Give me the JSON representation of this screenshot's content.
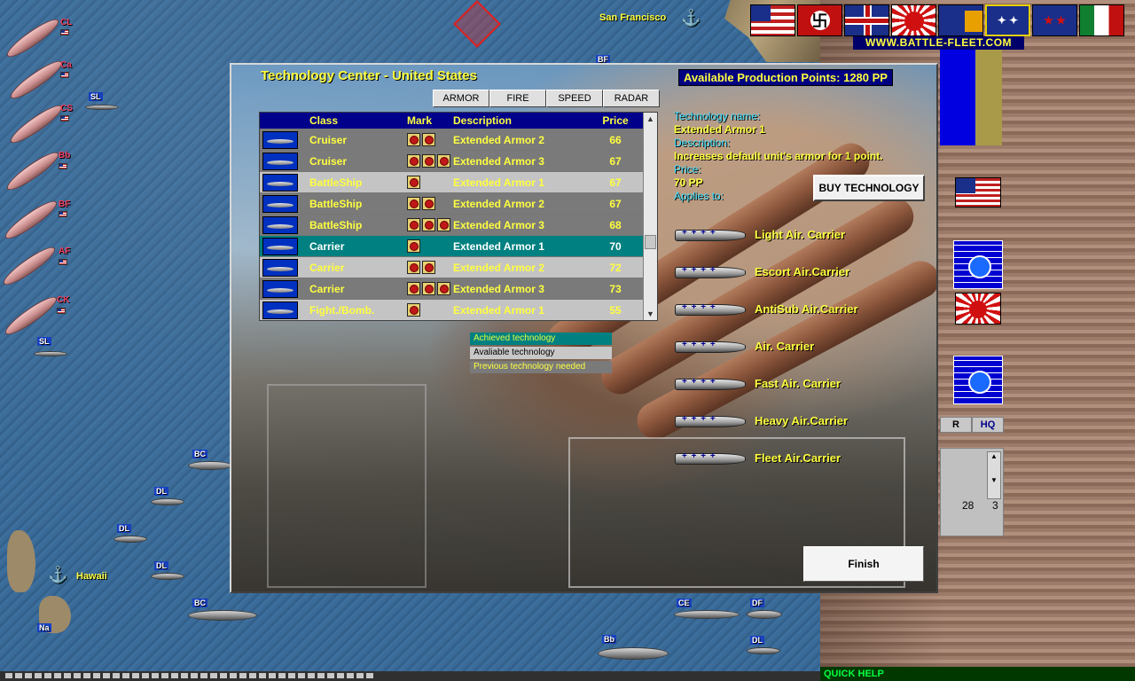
{
  "map": {
    "places": [
      "San Francisco",
      "Hawaii"
    ],
    "fleet_labels": [
      "CL",
      "Ca",
      "CS",
      "Bb",
      "BF",
      "AF",
      "CK"
    ],
    "unit_labels": [
      "SL",
      "SL",
      "BC",
      "DL",
      "DL",
      "DL",
      "BC",
      "Bb",
      "CE",
      "DF",
      "DL",
      "BF",
      "Na"
    ]
  },
  "site": {
    "link": "WWW.BATTLE-FLEET.COM"
  },
  "nations": [
    "usa-flag",
    "germany-flag",
    "uk-flag",
    "japan-flag",
    "australia-flag",
    "australia-flag-alt",
    "new-zealand-flag",
    "italy-flag"
  ],
  "sidebar": {
    "tab_r": "R",
    "tab_hq": "HQ",
    "num_a": "28",
    "num_b": "3"
  },
  "quick_help": "QUICK HELP",
  "dialog": {
    "title": "Technology Center - United States",
    "production": "Available Production Points: 1280 PP",
    "tabs": [
      "ARMOR",
      "FIRE",
      "SPEED",
      "RADAR"
    ],
    "columns": {
      "class": "Class",
      "mark": "Mark",
      "description": "Description",
      "price": "Price"
    },
    "rows": [
      {
        "class": "Cruiser",
        "marks": 2,
        "description": "Extended Armor 2",
        "price": "66",
        "status": "prev"
      },
      {
        "class": "Cruiser",
        "marks": 3,
        "description": "Extended Armor 3",
        "price": "67",
        "status": "prev"
      },
      {
        "class": "BattleShip",
        "marks": 1,
        "description": "Extended Armor 1",
        "price": "67",
        "status": "avail"
      },
      {
        "class": "BattleShip",
        "marks": 2,
        "description": "Extended Armor 2",
        "price": "67",
        "status": "prev"
      },
      {
        "class": "BattleShip",
        "marks": 3,
        "description": "Extended Armor 3",
        "price": "68",
        "status": "prev"
      },
      {
        "class": "Carrier",
        "marks": 1,
        "description": "Extended Armor 1",
        "price": "70",
        "status": "achieved"
      },
      {
        "class": "Carrier",
        "marks": 2,
        "description": "Extended Armor 2",
        "price": "72",
        "status": "avail"
      },
      {
        "class": "Carrier",
        "marks": 3,
        "description": "Extended Armor 3",
        "price": "73",
        "status": "prev"
      },
      {
        "class": "Fight./Bomb.",
        "marks": 1,
        "description": "Extended Armor 1",
        "price": "55",
        "status": "avail"
      }
    ],
    "legend": {
      "achieved": "Achieved technology",
      "available": "Avaliable technology",
      "previous": "Previous technology needed"
    },
    "info": {
      "name_label": "Technology name:",
      "name_value": "Extended Armor 1",
      "desc_label": "Description:",
      "desc_value": "Increases default unit's armor for 1 point.",
      "price_label": "Price:",
      "price_value": "70 PP",
      "applies_label": "Applies to:"
    },
    "buy_label": "BUY TECHNOLOGY",
    "applies_to": [
      "Light Air. Carrier",
      "Escort Air.Carrier",
      "AntiSub Air.Carrier",
      "Air. Carrier",
      "Fast Air. Carrier",
      "Heavy Air.Carrier",
      "Fleet Air.Carrier"
    ],
    "finish_label": "Finish"
  },
  "colors": {
    "title_yellow": "#ffff40",
    "header_navy": "#00008b",
    "achieved_teal": "#008080",
    "info_cyan": "#40e0ff"
  }
}
